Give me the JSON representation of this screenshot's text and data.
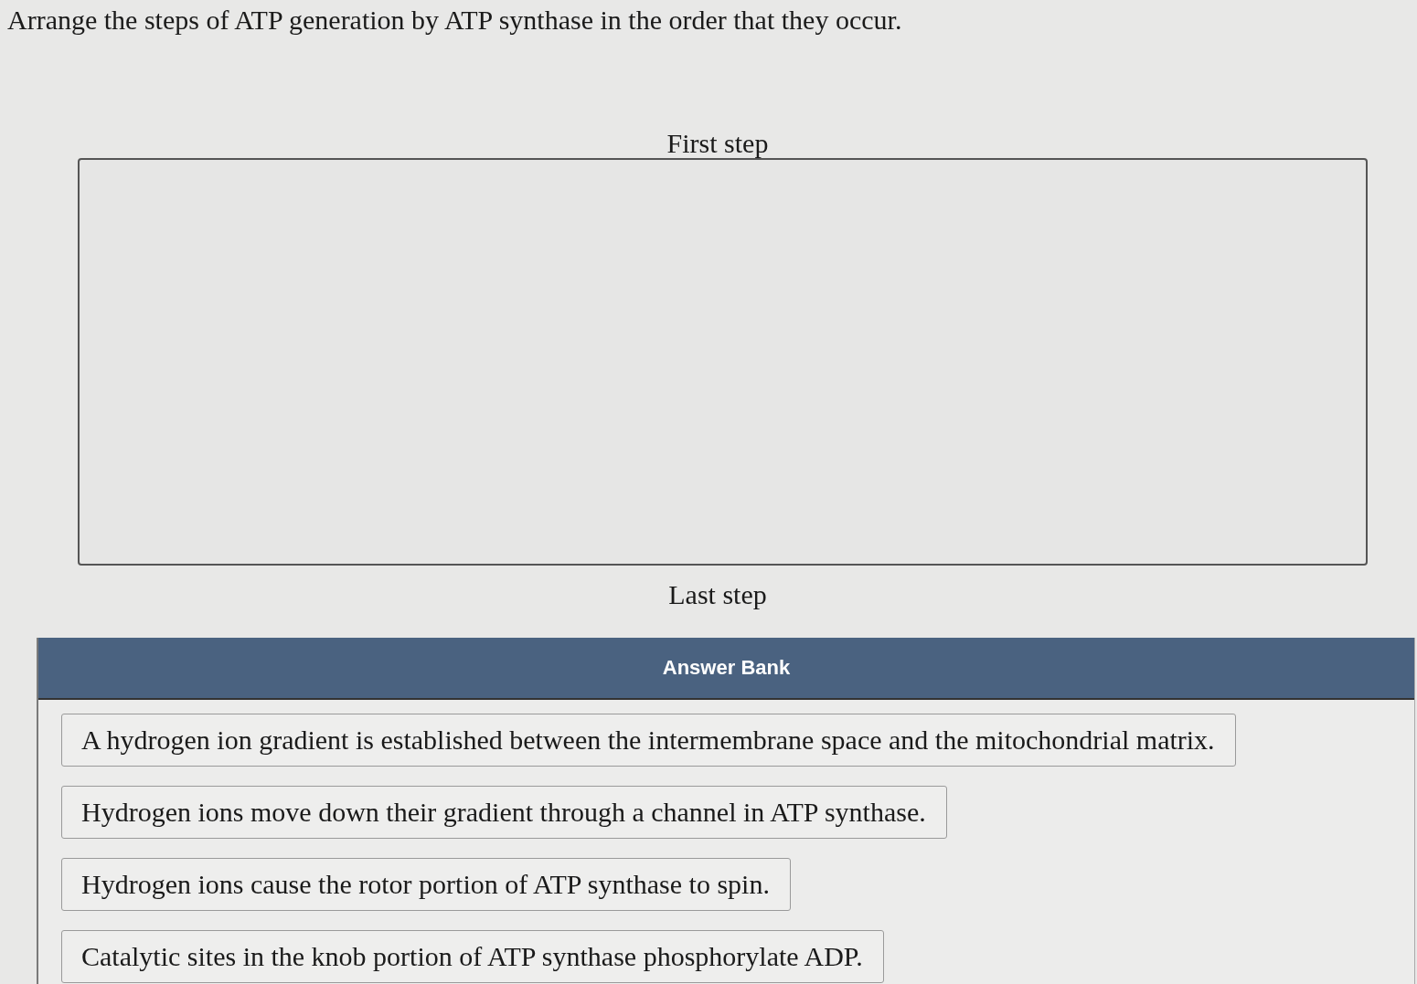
{
  "instruction": "Arrange the steps of ATP generation by ATP synthase in the order that they occur.",
  "sequence": {
    "first_label": "First step",
    "last_label": "Last step"
  },
  "answer_bank": {
    "title": "Answer Bank",
    "items": [
      "A hydrogen ion gradient is established between the intermembrane space and the mitochondrial matrix.",
      "Hydrogen ions move down their gradient through a channel in ATP synthase.",
      "Hydrogen ions cause the rotor portion of ATP synthase to spin.",
      "Catalytic sites in the knob portion of ATP synthase phosphorylate ADP."
    ]
  }
}
